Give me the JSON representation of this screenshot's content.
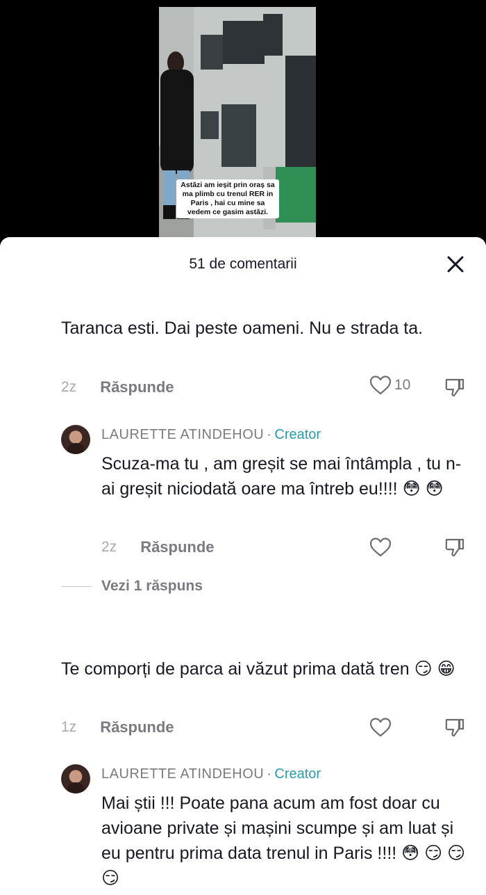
{
  "video": {
    "caption": "Astăzi am ieșit prin oraș sa ma plimb cu trenul RER in Paris , hai cu mine sa vedem ce gasim astăzi."
  },
  "sheet": {
    "title": "51 de comentarii",
    "close_icon": "close-icon"
  },
  "comments": [
    {
      "text": "Taranca esti. Dai peste oameni. Nu e strada ta.",
      "time": "2z",
      "reply_label": "Răspunde",
      "likes": "10"
    },
    {
      "author": "LAURETTE ATINDEHOU",
      "separator": "·",
      "badge": "Creator",
      "text": "Scuza-ma tu , am greșit se mai întâmpla , tu n-ai greșit niciodată oare ma întreb eu!!!! 😳 😳",
      "time": "2z",
      "reply_label": "Răspunde",
      "likes": ""
    },
    {
      "text": "Te comporți de parca ai văzut prima dată tren 😏 😁",
      "time": "1z",
      "reply_label": "Răspunde",
      "likes": ""
    },
    {
      "author": "LAURETTE ATINDEHOU",
      "separator": "·",
      "badge": "Creator",
      "text": "Mai știi !!! Poate pana acum am fost doar cu avioane private și mașini scumpe și am luat și eu pentru prima data trenul in Paris !!!! 😳 😏 😏 😏"
    }
  ],
  "view_replies": "Vezi 1 răspuns",
  "colors": {
    "creator_badge": "#2a9ba8",
    "secondary_text": "#7a7b81",
    "primary_text": "#161823"
  }
}
